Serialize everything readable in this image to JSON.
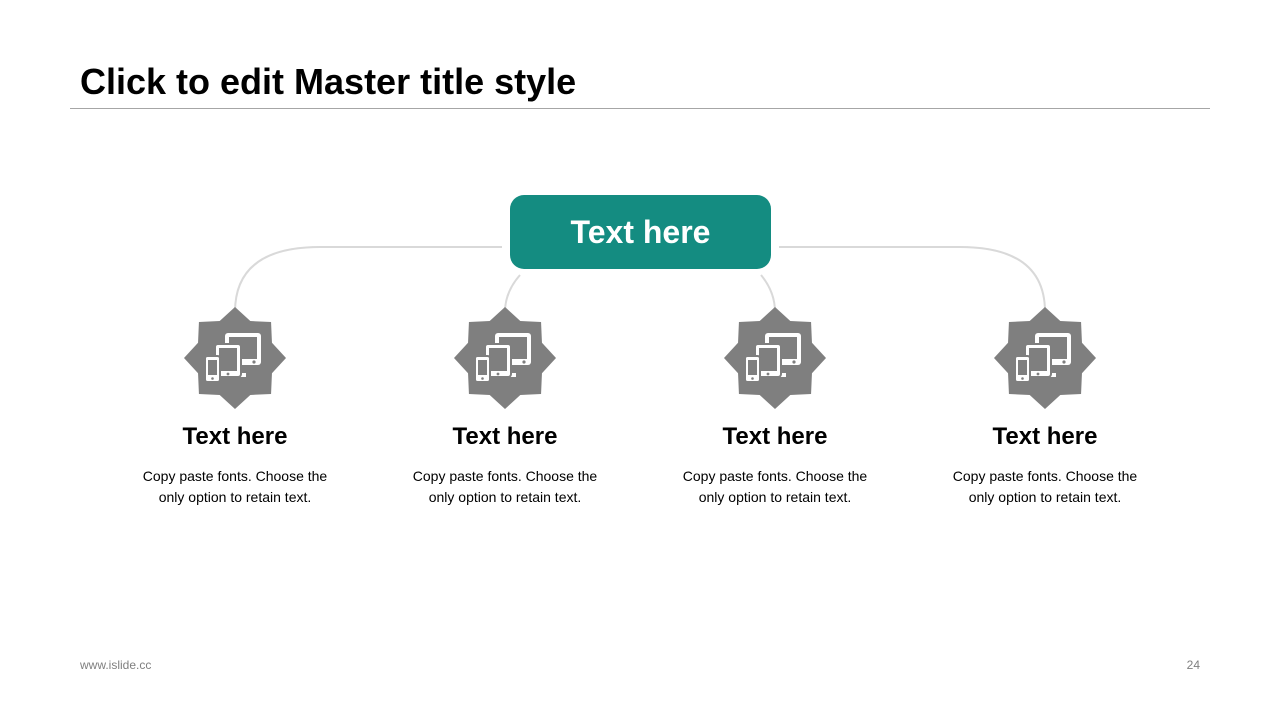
{
  "slide": {
    "title": "Click to edit Master title style",
    "footer_url": "www.islide.cc",
    "page_number": "24"
  },
  "colors": {
    "accent": "#148c81",
    "badge": "#7f7f7f",
    "connector": "#d9d9d9",
    "icon": "#ffffff"
  },
  "diagram": {
    "center_label": "Text here",
    "nodes": [
      {
        "title": "Text here",
        "description": "Copy paste fonts. Choose the only option to retain text.",
        "icon": "devices-icon"
      },
      {
        "title": "Text here",
        "description": "Copy paste fonts. Choose the only option to retain text.",
        "icon": "devices-icon"
      },
      {
        "title": "Text here",
        "description": "Copy paste fonts. Choose the only option to retain text.",
        "icon": "devices-icon"
      },
      {
        "title": "Text here",
        "description": "Copy paste fonts. Choose the only option to retain text.",
        "icon": "devices-icon"
      }
    ]
  }
}
